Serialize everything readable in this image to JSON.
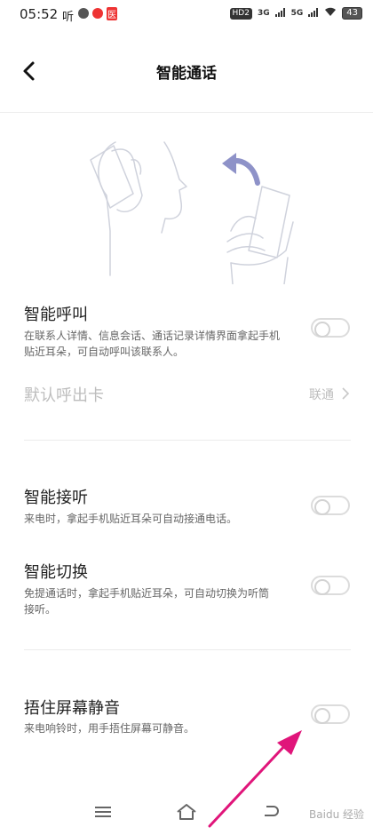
{
  "status_bar": {
    "time": "05:52",
    "app_icons": [
      "听",
      "微博",
      "微博",
      "医"
    ],
    "hd": "HD2",
    "network1": "3G",
    "network2": "5G",
    "battery": "43"
  },
  "header": {
    "title": "智能通话",
    "back_icon": "chevron-left-icon"
  },
  "settings": {
    "smart_call": {
      "title": "智能呼叫",
      "desc": "在联系人详情、信息会话、通话记录详情界面拿起手机贴近耳朵，可自动呼叫该联系人。",
      "enabled": false
    },
    "default_card": {
      "title": "默认呼出卡",
      "value": "联通"
    },
    "smart_answer": {
      "title": "智能接听",
      "desc": "来电时，拿起手机贴近耳朵可自动接通电话。",
      "enabled": false
    },
    "smart_switch": {
      "title": "智能切换",
      "desc": "免提通话时，拿起手机贴近耳朵，可自动切换为听筒接听。",
      "enabled": false
    },
    "cover_mute": {
      "title": "捂住屏幕静音",
      "desc": "来电响铃时，用手捂住屏幕可静音。",
      "enabled": false
    }
  },
  "nav_bar": {
    "menu_icon": "menu-icon",
    "home_icon": "home-icon",
    "back_icon": "back-icon",
    "watermark": "Baidu 经验"
  },
  "colors": {
    "annotation_arrow": "#e0157a",
    "illustration_arrow": "#8e92c8"
  }
}
